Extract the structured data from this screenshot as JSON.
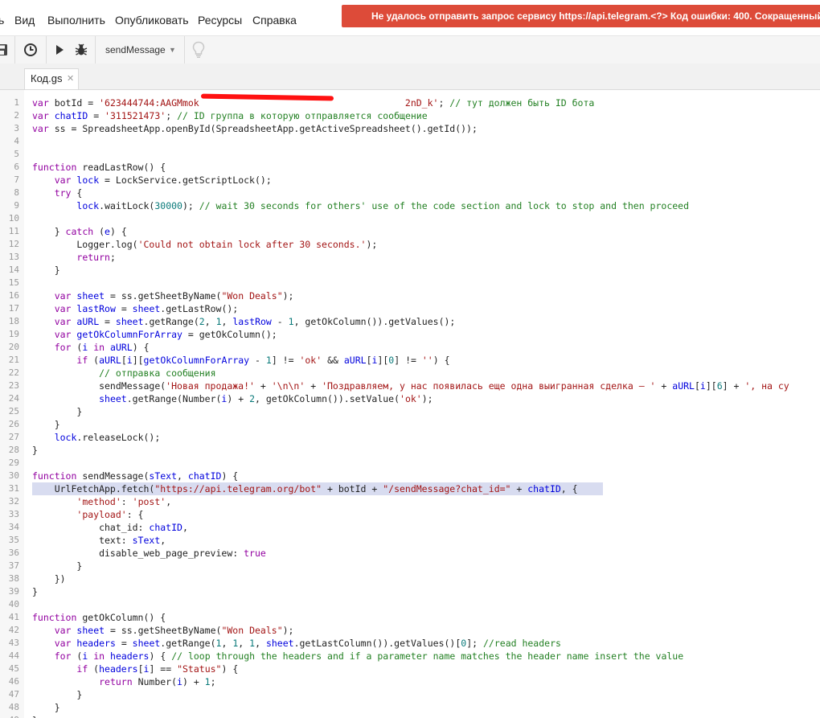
{
  "menu": {
    "items": [
      "ь",
      "Вид",
      "Выполнить",
      "Опубликовать",
      "Ресурсы",
      "Справка"
    ]
  },
  "error_banner": {
    "text": "Не удалось отправить запрос сервису https://api.telegram.<?> Код ошибки: 400. Сокращенный ответ сервера:"
  },
  "toolbar": {
    "function_select_value": "sendMessage",
    "icons": [
      "save-icon",
      "trigger-clock-icon",
      "run-icon",
      "debug-bug-icon",
      "lightbulb-icon"
    ]
  },
  "file_tab": {
    "label": "Код.gs"
  },
  "colors": {
    "banner": "#dd4b39",
    "keyword": "#9200a0",
    "string": "#a31515",
    "comment": "#238023",
    "variable": "#0000dd",
    "highlight": "#d8dcf0"
  },
  "editor": {
    "highlighted_line": 31,
    "lines": [
      "var botId = '623444744:AAGMmok                                     2nD_k'; // тут должен быть ID бота",
      "var chatID = '311521473'; // ID группа в которую отправляется сообщение",
      "var ss = SpreadsheetApp.openById(SpreadsheetApp.getActiveSpreadsheet().getId());",
      "",
      "",
      "function readLastRow() {",
      "    var lock = LockService.getScriptLock();",
      "    try {",
      "        lock.waitLock(30000); // wait 30 seconds for others' use of the code section and lock to stop and then proceed",
      "",
      "    } catch (e) {",
      "        Logger.log('Could not obtain lock after 30 seconds.');",
      "        return;",
      "    }",
      "",
      "    var sheet = ss.getSheetByName(\"Won Deals\");",
      "    var lastRow = sheet.getLastRow();",
      "    var aURL = sheet.getRange(2, 1, lastRow - 1, getOkColumn()).getValues();",
      "    var getOkColumnForArray = getOkColumn();",
      "    for (i in aURL) {",
      "        if (aURL[i][getOkColumnForArray - 1] != 'ok' && aURL[i][0] != '') {",
      "            // отправка сообщения",
      "            sendMessage('Новая продажа!' + '\\n\\n' + 'Поздравляем, у нас появилась еще одна выигранная сделка – ' + aURL[i][6] + ', на су",
      "            sheet.getRange(Number(i) + 2, getOkColumn()).setValue('ok');",
      "        }",
      "    }",
      "    lock.releaseLock();",
      "}",
      "",
      "function sendMessage(sText, chatID) {",
      "    UrlFetchApp.fetch(\"https://api.telegram.org/bot\" + botId + \"/sendMessage?chat_id=\" + chatID, {",
      "        'method': 'post',",
      "        'payload': {",
      "            chat_id: chatID,",
      "            text: sText,",
      "            disable_web_page_preview: true",
      "        }",
      "    })",
      "}",
      "",
      "function getOkColumn() {",
      "    var sheet = ss.getSheetByName(\"Won Deals\");",
      "    var headers = sheet.getRange(1, 1, 1, sheet.getLastColumn()).getValues()[0]; //read headers",
      "    for (i in headers) { // loop through the headers and if a parameter name matches the header name insert the value",
      "        if (headers[i] == \"Status\") {",
      "            return Number(i) + 1;",
      "        }",
      "    }",
      "}"
    ]
  }
}
